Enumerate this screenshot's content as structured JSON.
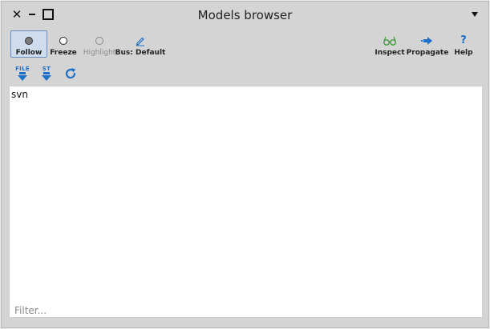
{
  "window": {
    "title": "Models browser"
  },
  "toolbar": {
    "follow": "Follow",
    "freeze": "Freeze",
    "highlight": "Highlight",
    "bus": "Bus: Default",
    "inspect": "Inspect",
    "propagate": "Propagate",
    "help": "Help"
  },
  "toolbar2": {
    "file_label": "FILE",
    "st_label": "ST"
  },
  "icons": {
    "close": "close-icon",
    "minimize": "minimize-icon",
    "maximize": "maximize-icon",
    "menu": "menu-arrow-icon",
    "pencil": "pencil-icon",
    "glasses": "glasses-icon",
    "propagate": "arrow-right-icon",
    "help": "question-icon",
    "refresh": "refresh-icon"
  },
  "colors": {
    "accent": "#1e6fc8",
    "selected_bg": "#cfdcee",
    "inspect_green": "#3f9a3f"
  },
  "list": {
    "items": [
      "svn"
    ]
  },
  "filter": {
    "placeholder": "Filter...",
    "value": ""
  }
}
